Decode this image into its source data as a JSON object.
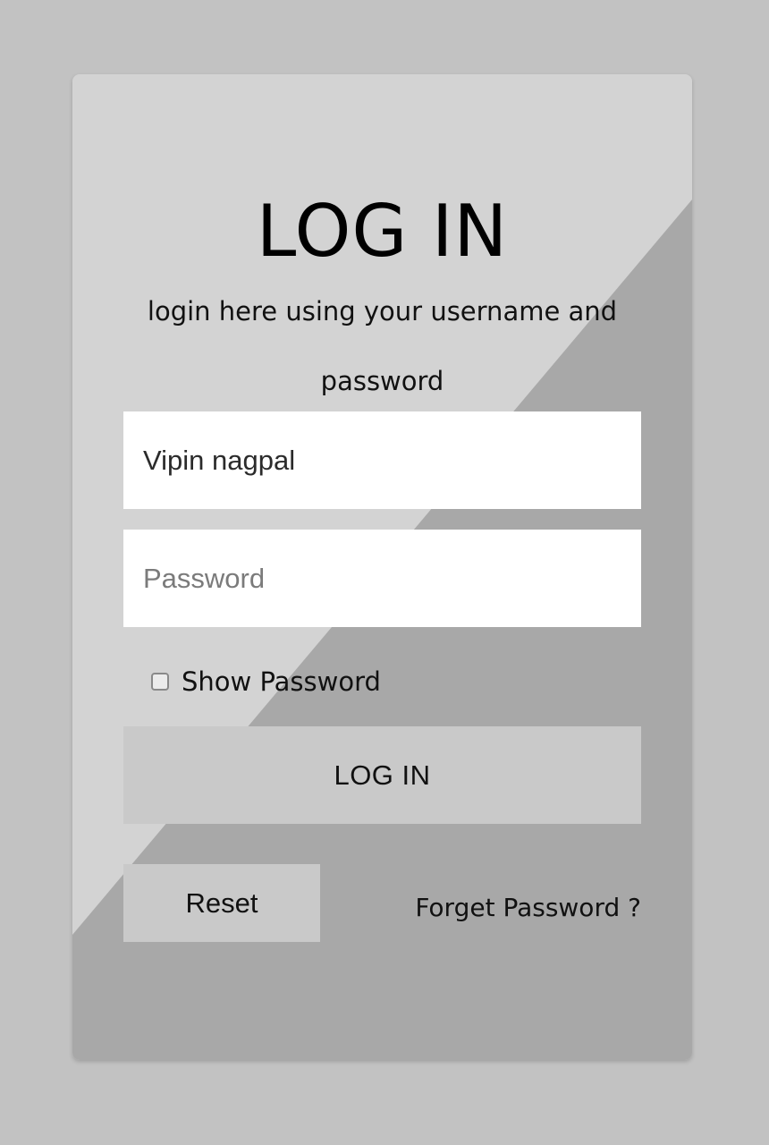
{
  "colors": {
    "page_background": "#c2c2c2",
    "card_light": "#d3d3d3",
    "card_dark": "#a8a8a8",
    "input_background": "#ffffff",
    "button_background": "#c9c9c9"
  },
  "login": {
    "title": "LOG IN",
    "subtitle": "login here using your username and password",
    "username": {
      "value": "Vipin nagpal",
      "placeholder": ""
    },
    "password": {
      "value": "",
      "placeholder": "Password"
    },
    "show_password": {
      "label": "Show Password",
      "checked": false
    },
    "login_button_label": "LOG IN",
    "reset_button_label": "Reset",
    "forget_password_link": "Forget Password ?"
  }
}
